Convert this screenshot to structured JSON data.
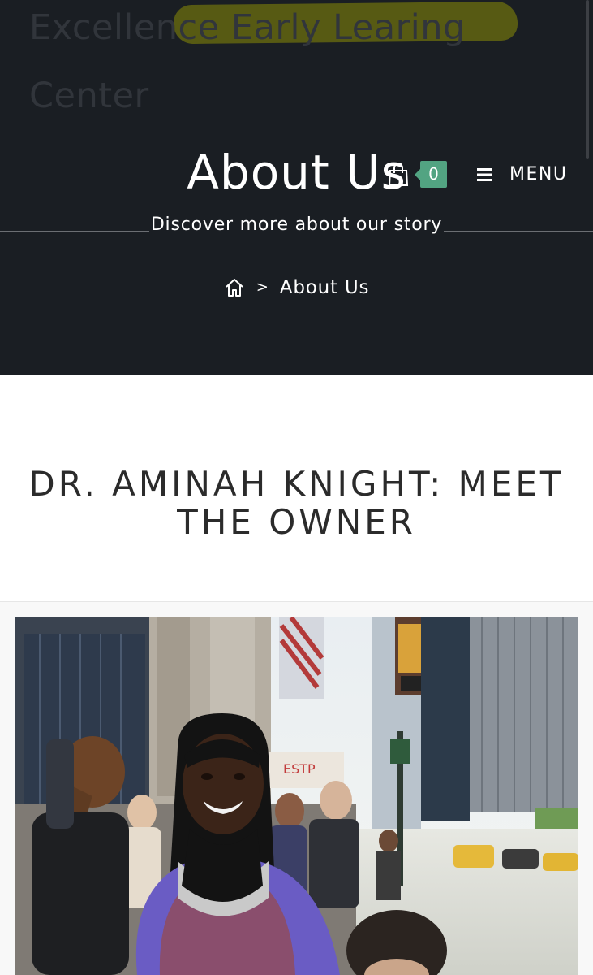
{
  "site": {
    "title": "Excellence Early Learing Center"
  },
  "hero": {
    "title": "About Us",
    "subtitle": "Discover more about our story"
  },
  "header": {
    "cart_icon": "shopping-bag-icon",
    "cart_count": "0",
    "menu_icon": "hamburger-icon",
    "menu_label": "MENU"
  },
  "breadcrumb": {
    "home_icon": "home-icon",
    "separator": ">",
    "current": "About Us"
  },
  "main": {
    "heading": "DR. AMINAH KNIGHT: MEET THE OWNER"
  },
  "colors": {
    "header_bg": "#1a1e23",
    "cart_badge": "#52a482",
    "highlight": "#5b5e13",
    "heading_text": "#2b2b2b"
  }
}
